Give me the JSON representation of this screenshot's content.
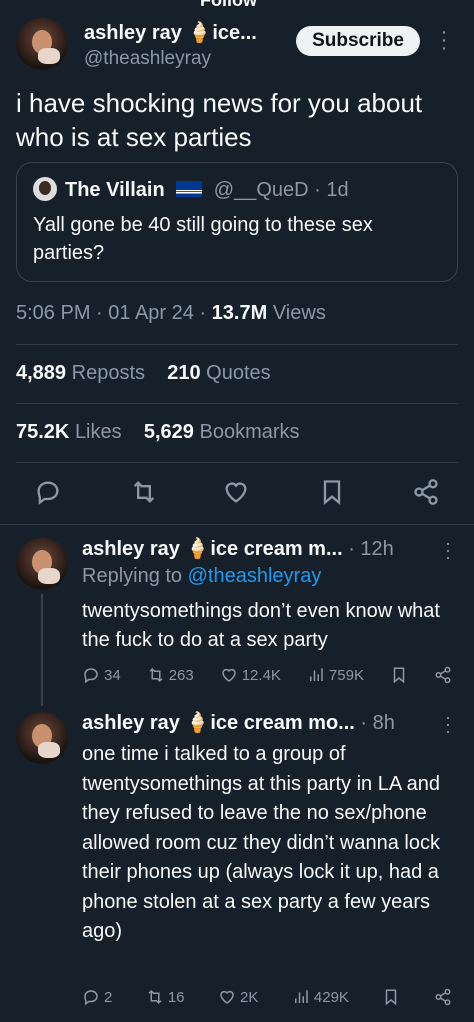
{
  "header": {
    "partial_text": "Follow"
  },
  "author": {
    "name": "ashley ray",
    "name_suffix": "ice...",
    "handle": "@theashleyray",
    "subscribe_label": "Subscribe"
  },
  "tweet": {
    "text": "i have shocking news for you about who is at sex parties",
    "time": "5:06 PM",
    "date": "01 Apr 24",
    "views_count": "13.7M",
    "views_label": "Views"
  },
  "quote": {
    "name": "The Villain",
    "handle": "@__QueD",
    "age": "1d",
    "text": "Yall gone be 40 still going to these sex parties?"
  },
  "stats": {
    "reposts_count": "4,889",
    "reposts_label": "Reposts",
    "quotes_count": "210",
    "quotes_label": "Quotes",
    "likes_count": "75.2K",
    "likes_label": "Likes",
    "bookmarks_count": "5,629",
    "bookmarks_label": "Bookmarks"
  },
  "replies": [
    {
      "name": "ashley ray",
      "name_suffix": "ice cream m...",
      "age": "12h",
      "replying_prefix": "Replying to",
      "replying_handle": "@theashleyray",
      "text": "twentysomethings don’t even know what the fuck to do at a sex party",
      "replies": "34",
      "reposts": "263",
      "likes": "12.4K",
      "views": "759K"
    },
    {
      "name": "ashley ray",
      "name_suffix": "ice cream mo...",
      "age": "8h",
      "text": "one time i talked to a group of twentysomethings at this party in LA and they refused to leave the no sex/phone allowed room cuz they didn’t wanna lock their phones up (always lock it up, had a phone stolen at a sex party a few years ago)",
      "replies": "2",
      "reposts": "16",
      "likes": "2K",
      "views": "429K"
    }
  ],
  "colors": {
    "bg": "#15202b",
    "text": "#f7f9f9",
    "muted": "#8b98a5",
    "link": "#1d9bf0",
    "divider": "#2f3b47"
  }
}
